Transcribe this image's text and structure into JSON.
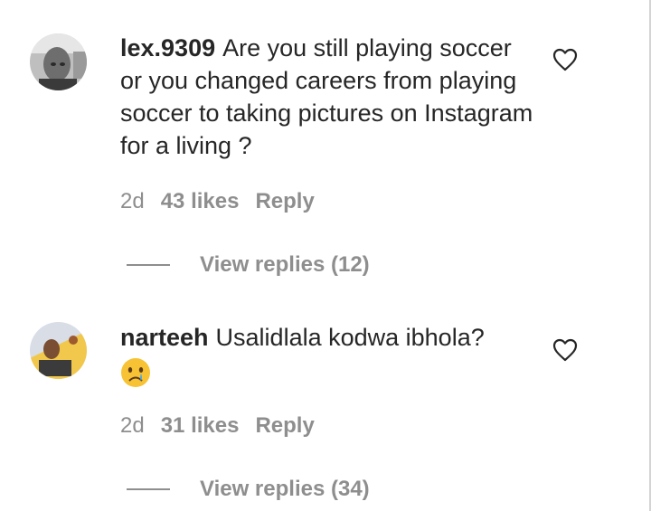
{
  "comments": [
    {
      "username": "lex.9309",
      "text": "Are you still playing soccer or you changed careers from playing soccer to taking pictures on Instagram for a living ?",
      "time": "2d",
      "likes": "43 likes",
      "reply": "Reply",
      "view_replies": "View replies (12)",
      "avatar_icon": "user-photo-avatar",
      "heart_icon": "heart-outline-icon"
    },
    {
      "username": "narteeh",
      "text": "Usalidlala kodwa ibhola?",
      "emoji": "crying-face-emoji",
      "time": "2d",
      "likes": "31 likes",
      "reply": "Reply",
      "view_replies": "View replies (34)",
      "avatar_icon": "user-photo-avatar",
      "heart_icon": "heart-outline-icon"
    }
  ],
  "colors": {
    "text": "#262626",
    "secondary": "#8e8e8e",
    "background": "#ffffff"
  }
}
